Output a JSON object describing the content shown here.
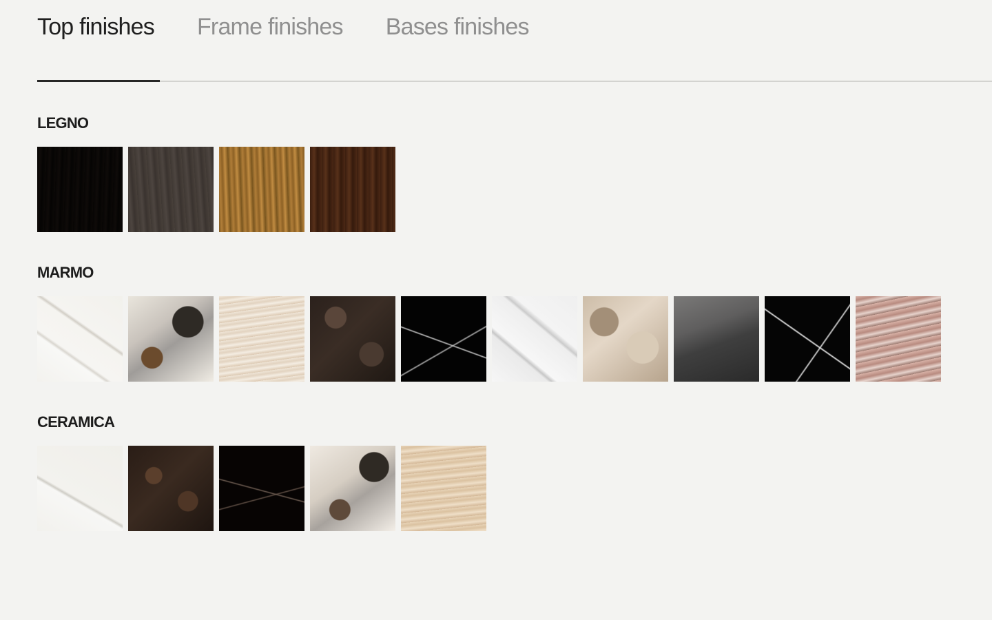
{
  "tabs": [
    {
      "label": "Top finishes",
      "active": true
    },
    {
      "label": "Frame finishes",
      "active": false
    },
    {
      "label": "Bases finishes",
      "active": false
    }
  ],
  "sections": [
    {
      "title": "LEGNO",
      "swatches": [
        {
          "name": "legno-1",
          "background": "repeating-linear-gradient(92deg, #070504 0px, #0f0b09 5px, #050403 9px, #0c0907 14px)"
        },
        {
          "name": "legno-2",
          "background": "repeating-linear-gradient(86deg, #3f3833 0px, #4d4540 6px, #3a332f 11px, #48403a 17px)"
        },
        {
          "name": "legno-3",
          "background": "repeating-linear-gradient(88deg, #7e5a22 0px, #b07d38 4px, #8d6125 8px, #c18c42 12px, #76521c 17px)"
        },
        {
          "name": "legno-4",
          "background": "repeating-linear-gradient(90deg, #3c1e0f 0px, #58311a 6px, #351a0c 11px, #4b2815 17px)"
        }
      ]
    },
    {
      "title": "MARMO",
      "swatches": [
        {
          "name": "marmo-1",
          "background": "linear-gradient(35deg, #f3f2ee 0%, #f8f8f6 32%, #d9d6cf 34%, #f6f5f2 36%, #f5f4f0 58%, #d2cec6 60%, #f5f4f1 62%, #f2f1ec 100%)"
        },
        {
          "name": "marmo-2",
          "background": "radial-gradient(circle at 70% 30%, #2e2a25 0 18%, transparent 19%), radial-gradient(circle at 28% 72%, #6b4b2d 0 12%, transparent 13%), linear-gradient(145deg, #e9e5dc 0%, #c9c3bc 35%, #9f9c99 55%, #f0ece4 100%)"
        },
        {
          "name": "marmo-3",
          "background": "repeating-linear-gradient(172deg, #efe5d7 0px, #e2d3c0 4px, #f4ede2 8px, #dcc9b2 13px)"
        },
        {
          "name": "marmo-4",
          "background": "radial-gradient(circle at 30% 25%, #5a463a 0 12%, transparent 13%), radial-gradient(circle at 72% 68%, #4a3a30 0 14%, transparent 15%), linear-gradient(135deg, #2b211c 0%, #3a2d25 45%, #1f1813 100%)"
        },
        {
          "name": "marmo-5",
          "background": "linear-gradient(20deg, transparent 0 46%, #bfbfbf 47%, transparent 48%), linear-gradient(150deg, transparent 0 58%, #a8a8a8 59%, transparent 60%), #030303"
        },
        {
          "name": "marmo-6",
          "background": "linear-gradient(40deg, #f6f6f6 0%, #eaeaea 30%, #c7c7c7 32%, #f7f7f7 35%, #eeeeee 60%, #cbcbcb 62%, #f4f4f4 66%, #efefef 100%)"
        },
        {
          "name": "marmo-7",
          "background": "radial-gradient(circle at 25% 30%, #a38f78 0 16%, transparent 17%), radial-gradient(circle at 70% 60%, #d9cbb7 0 20%, transparent 21%), linear-gradient(140deg, #cdbda8 0%, #e4d7c7 40%, #b7a48d 100%)"
        },
        {
          "name": "marmo-8",
          "background": "linear-gradient(160deg, #7a7978 0%, #5f5e5e 35%, #3f3f3f 55%, #2a2a2a 100%)"
        },
        {
          "name": "marmo-9",
          "background": "linear-gradient(35deg, transparent 0 49%, #e9e9e9 50%, transparent 51%), linear-gradient(125deg, transparent 0 62%, #d8d8d8 63%, transparent 64%), #050505"
        },
        {
          "name": "marmo-10",
          "background": "repeating-linear-gradient(168deg, #d8b2a7 0px, #b88b80 6px, #e7d3cc 11px, #9c7a70 16px)"
        }
      ]
    },
    {
      "title": "CERAMICA",
      "swatches": [
        {
          "name": "ceramica-1",
          "background": "linear-gradient(30deg, #f2f1ed 0%, #f7f7f5 38%, #cfcdc6 40%, #f3f2ee 42%, #f0efea 100%)"
        },
        {
          "name": "ceramica-2",
          "background": "radial-gradient(circle at 30% 35%, #5b3f2c 0 10%, transparent 11%), radial-gradient(circle at 70% 65%, #4f3626 0 12%, transparent 13%), linear-gradient(135deg, #2a1d16 0%, #3a2a20 45%, #1e1510 100%)"
        },
        {
          "name": "ceramica-3",
          "background": "linear-gradient(15deg, transparent 0 47%, #6a5a4f 48%, transparent 49%), linear-gradient(165deg, transparent 0 58%, #5c4c42 59%, transparent 60%), #070403"
        },
        {
          "name": "ceramica-4",
          "background": "radial-gradient(circle at 75% 25%, #2f2a24 0 16%, transparent 17%), radial-gradient(circle at 35% 75%, #5e4a3a 0 12%, transparent 13%), linear-gradient(145deg, #efe9e1 0%, #d6cec3 40%, #a7a29d 60%, #f3eee7 100%)"
        },
        {
          "name": "ceramica-5",
          "background": "repeating-linear-gradient(174deg, #e7d3b7 0px, #dbc2a1 4px, #efdfc8 9px, #d3b796 14px)"
        }
      ]
    }
  ]
}
